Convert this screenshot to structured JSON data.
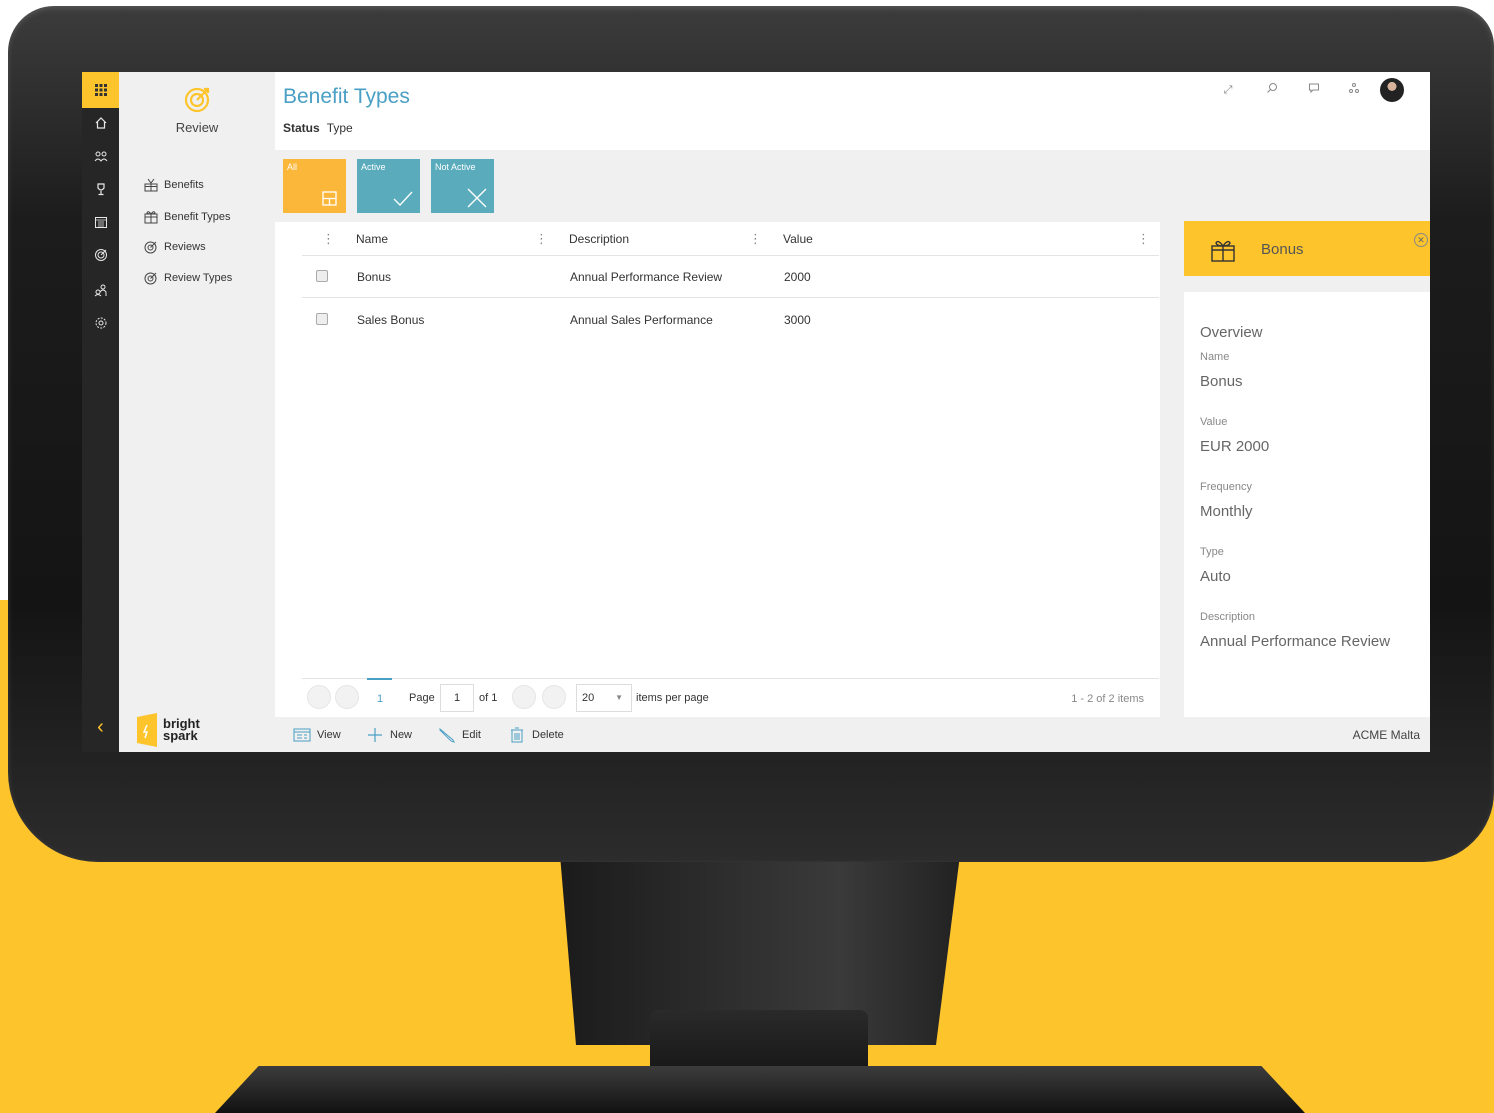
{
  "app": {
    "name": "Review",
    "brand": "bright spark",
    "brand_line1": "bright",
    "brand_line2": "spark",
    "tenant": "ACME Malta",
    "accent": "#fec42c",
    "title_color": "#4a9fc5",
    "tile_color": "#5aabbc"
  },
  "rail": {
    "items": [
      {
        "icon": "home-icon"
      },
      {
        "icon": "people-icon"
      },
      {
        "icon": "trophy-icon"
      },
      {
        "icon": "calendar-icon"
      },
      {
        "icon": "target-icon"
      },
      {
        "icon": "org-icon"
      },
      {
        "icon": "settings-icon"
      }
    ]
  },
  "nav": {
    "items": [
      {
        "label": "Benefits",
        "icon": "benefits-icon"
      },
      {
        "label": "Benefit Types",
        "icon": "gift-icon"
      },
      {
        "label": "Reviews",
        "icon": "target-icon"
      },
      {
        "label": "Review Types",
        "icon": "target-icon"
      }
    ]
  },
  "page": {
    "title": "Benefit Types",
    "pivots": [
      "Status",
      "Type"
    ]
  },
  "filters": {
    "tiles": [
      {
        "label": "All",
        "icon": "grid-icon"
      },
      {
        "label": "Active",
        "icon": "check-icon"
      },
      {
        "label": "Not Active",
        "icon": "cross-icon"
      }
    ]
  },
  "table": {
    "columns": [
      "Name",
      "Description",
      "Value"
    ],
    "rows": [
      {
        "name": "Bonus",
        "description": "Annual Performance Review",
        "value": "2000"
      },
      {
        "name": "Sales Bonus",
        "description": "Annual Sales Performance",
        "value": "3000"
      }
    ]
  },
  "pager": {
    "current_page": "1",
    "page_label": "Page",
    "page_input": "1",
    "of_label": "of 1",
    "page_size": "20",
    "per_page_label": "items per page",
    "count": "1 - 2 of 2 items"
  },
  "commands": [
    {
      "label": "View",
      "icon": "view-icon"
    },
    {
      "label": "New",
      "icon": "plus-icon"
    },
    {
      "label": "Edit",
      "icon": "pencil-icon"
    },
    {
      "label": "Delete",
      "icon": "trash-icon"
    }
  ],
  "panel": {
    "title": "Bonus",
    "icon": "gift-icon",
    "section": "Overview",
    "fields": [
      {
        "label": "Name",
        "value": "Bonus"
      },
      {
        "label": "Value",
        "value": "EUR 2000"
      },
      {
        "label": "Frequency",
        "value": "Monthly"
      },
      {
        "label": "Type",
        "value": "Auto"
      },
      {
        "label": "Description",
        "value": "Annual Performance Review"
      }
    ]
  }
}
